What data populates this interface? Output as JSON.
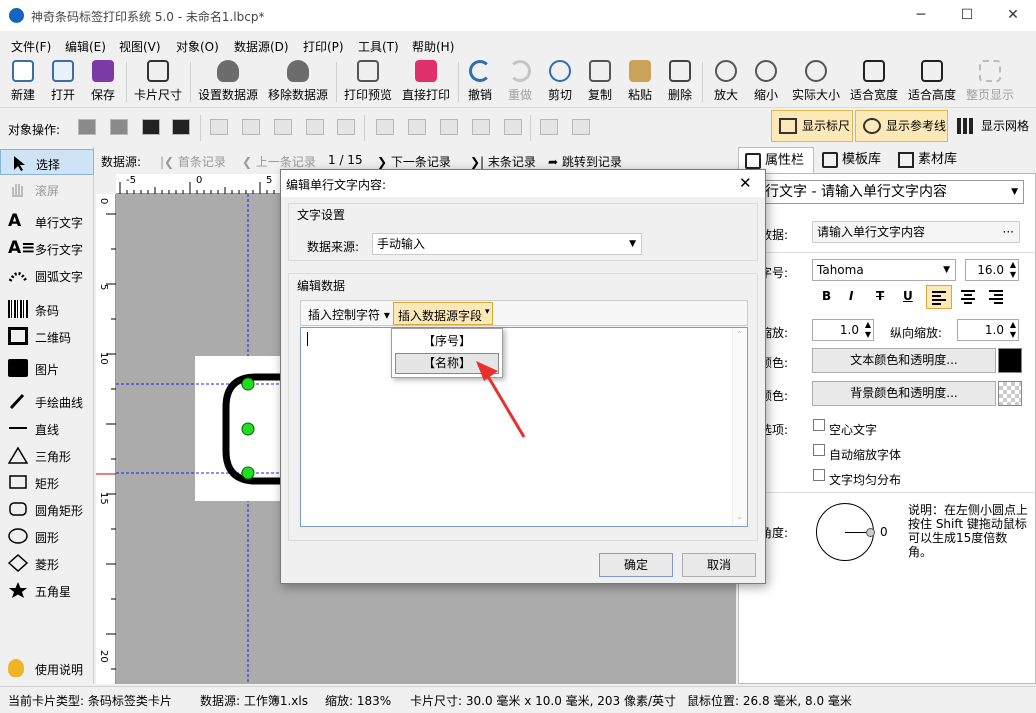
{
  "window": {
    "title": "神奇条码标签打印系统 5.0 - 未命名1.lbcp*",
    "min": "─",
    "max": "☐",
    "close": "✕"
  },
  "menu": [
    "文件(F)",
    "编辑(E)",
    "视图(V)",
    "对象(O)",
    "数据源(D)",
    "打印(P)",
    "工具(T)",
    "帮助(H)"
  ],
  "toolbar": [
    "新建",
    "打开",
    "保存",
    "卡片尺寸",
    "设置数据源",
    "移除数据源",
    "打印预览",
    "直接打印",
    "撤销",
    "重做",
    "剪切",
    "复制",
    "粘贴",
    "删除",
    "放大",
    "缩小",
    "实际大小",
    "适合宽度",
    "适合高度",
    "整页显示"
  ],
  "objbar": {
    "label": "对象操作:",
    "show_ruler": "显示标尺",
    "show_guides": "显示参考线",
    "show_grid": "显示网格"
  },
  "tools": [
    "选择",
    "滚屏",
    "单行文字",
    "多行文字",
    "圆弧文字",
    "条码",
    "二维码",
    "图片",
    "手绘曲线",
    "直线",
    "三角形",
    "矩形",
    "圆角矩形",
    "圆形",
    "菱形",
    "五角星",
    "使用说明"
  ],
  "nav": {
    "label": "数据源:",
    "first": "首条记录",
    "prev": "上一条记录",
    "page": "1 / 15",
    "next": "下一条记录",
    "last": "末条记录",
    "goto": "跳转到记录"
  },
  "ruler": {
    "h": [
      "-5",
      "0",
      "5"
    ],
    "v": [
      "0",
      "5",
      "10",
      "15",
      "20"
    ]
  },
  "panel": {
    "tabs": [
      "属性栏",
      "模板库",
      "素材库"
    ],
    "object": "行文字 - 请输入单行文字内容",
    "data_label": "本数据:",
    "data_value": "请输入单行文字内容",
    "font_label": "体字号:",
    "font_name": "Tahoma",
    "font_size": "16.0",
    "style_buttons": [
      "B",
      "I",
      "T",
      "U"
    ],
    "hscale_label": "向缩放:",
    "hscale": "1.0",
    "vscale_label": "纵向缩放:",
    "vscale": "1.0",
    "textcolor_label": "本颜色:",
    "textcolor_btn": "文本颜色和透明度...",
    "bgcolor_label": "景颜色:",
    "bgcolor_btn": "背景颜色和透明度...",
    "options_label": "本选项:",
    "opt1": "空心文字",
    "opt2": "自动缩放字体",
    "opt3": "文字均匀分布",
    "rotate_label": "转角度:",
    "rotate_value": "0",
    "note": "说明：在左侧小圆点上按住 Shift 键拖动鼠标可以生成15度倍数角。",
    "colors": {
      "text": "#000000"
    }
  },
  "dialog": {
    "title": "编辑单行文字内容:",
    "close": "✕",
    "group1": "文字设置",
    "source_label": "数据来源:",
    "source_value": "手动输入",
    "group2": "编辑数据",
    "insert_ctrl": "插入控制字符",
    "insert_field": "插入数据源字段",
    "menu_items": [
      "【序号】",
      "【名称】"
    ],
    "ok": "确定",
    "cancel": "取消"
  },
  "status": {
    "card_type": "当前卡片类型: 条码标签类卡片",
    "source": "数据源: 工作簿1.xls",
    "zoom": "缩放: 183%",
    "size": "卡片尺寸: 30.0 毫米 x 10.0 毫米, 203 像素/英寸",
    "mouse": "鼠标位置: 26.8 毫米, 8.0 毫米"
  }
}
